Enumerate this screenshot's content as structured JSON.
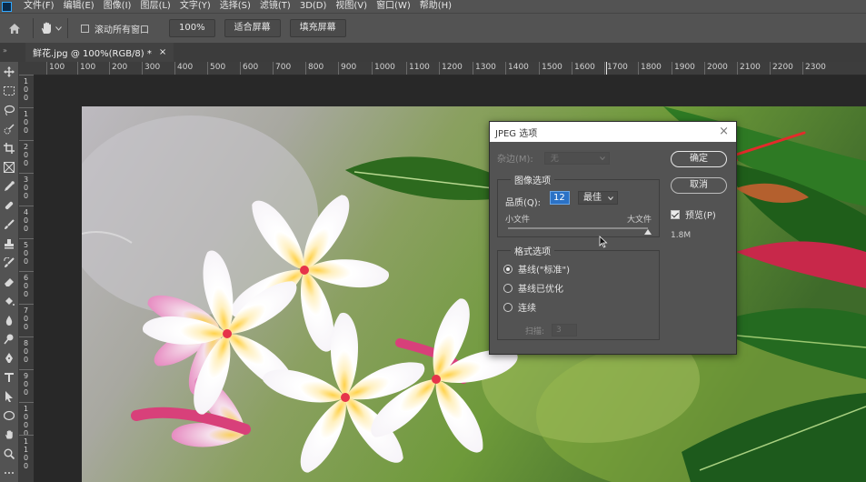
{
  "menu": [
    "文件(F)",
    "编辑(E)",
    "图像(I)",
    "图层(L)",
    "文字(Y)",
    "选择(S)",
    "滤镜(T)",
    "3D(D)",
    "视图(V)",
    "窗口(W)",
    "帮助(H)"
  ],
  "options_bar": {
    "scroll_all_label": "滚动所有窗口",
    "zoom_pct": "100%",
    "fit_screen": "适合屏幕",
    "fill_screen": "填充屏幕"
  },
  "document_tab": {
    "title": "鲜花.jpg @ 100%(RGB/8) *",
    "close": "×"
  },
  "ruler": {
    "h_labels": [
      "100",
      "100",
      "200",
      "300",
      "400",
      "500",
      "600",
      "700",
      "800",
      "900",
      "1000",
      "1100",
      "1200",
      "1300",
      "1400",
      "1500",
      "1600",
      "1700",
      "1800",
      "1900",
      "2000",
      "2100",
      "2200",
      "2300"
    ],
    "v_labels": [
      "100",
      "100",
      "200",
      "300",
      "400",
      "500",
      "600",
      "700",
      "800",
      "900",
      "1000",
      "1100"
    ]
  },
  "dialog": {
    "title": "JPEG 选项",
    "close": "×",
    "matte_label": "杂边(M):",
    "matte_value": "无",
    "image_options": "图像选项",
    "quality_label": "品质(Q):",
    "quality_value": "12",
    "quality_preset": "最佳",
    "small_file": "小文件",
    "large_file": "大文件",
    "quality_slider_fraction": 1.0,
    "format_options": "格式选项",
    "baseline_standard": "基线(\"标准\")",
    "baseline_optimized": "基线已优化",
    "progressive": "连续",
    "scans_label": "扫描:",
    "scans_value": "3",
    "ok": "确定",
    "cancel": "取消",
    "preview": "预览(P)",
    "file_size": "1.8M"
  }
}
